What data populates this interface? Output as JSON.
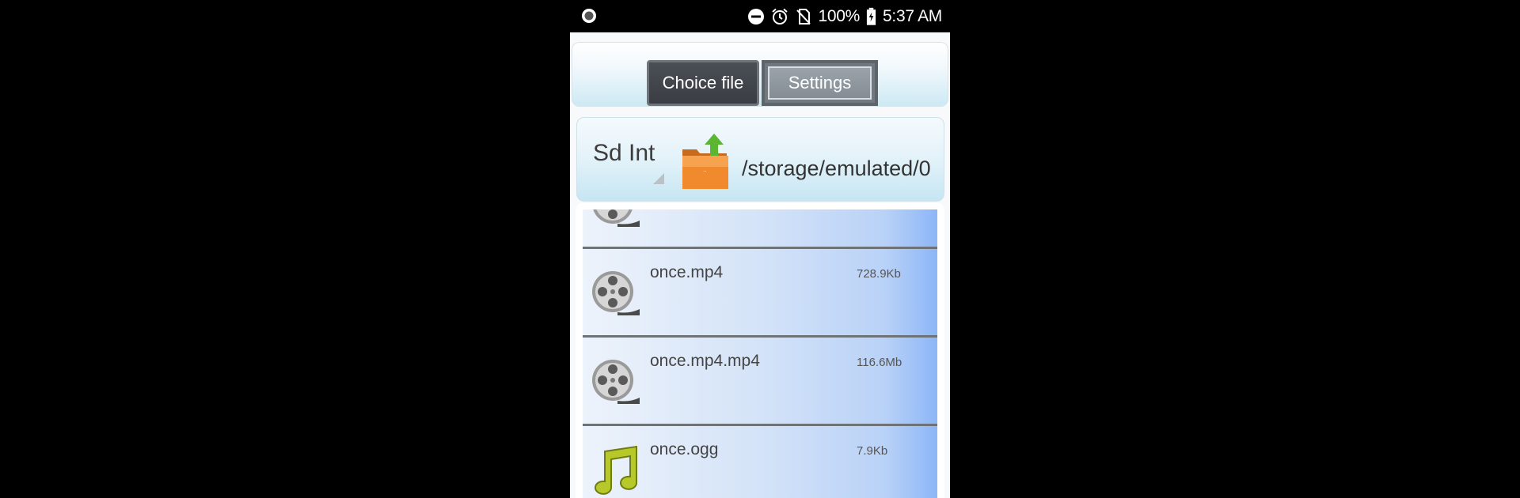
{
  "status_bar": {
    "left_icon": "circle-record-icon",
    "icons": [
      "do-not-disturb-icon",
      "alarm-clock-icon",
      "no-sim-icon"
    ],
    "battery_percent": "100%",
    "battery_icon": "battery-charging-icon",
    "time": "5:37 AM"
  },
  "tabs": {
    "choice_file": "Choice file",
    "settings": "Settings"
  },
  "path_bar": {
    "storage": "Sd Int",
    "folder_icon": "folder-up-icon",
    "path": "/storage/emulated/0"
  },
  "files": [
    {
      "name": "",
      "size": "",
      "icon": "film-reel-icon"
    },
    {
      "name": "once.mp4",
      "size": "728.9Kb",
      "icon": "film-reel-icon"
    },
    {
      "name": "once.mp4.mp4",
      "size": "116.6Mb",
      "icon": "film-reel-icon"
    },
    {
      "name": "once.ogg",
      "size": "7.9Kb",
      "icon": "music-note-icon"
    }
  ],
  "colors": {
    "tab_active_bg": "#3e4349",
    "tab_settings_bg": "#8b949b",
    "row_gradient_end": "#8db6f7",
    "folder_orange": "#f08a2c",
    "arrow_green": "#5cb531"
  }
}
